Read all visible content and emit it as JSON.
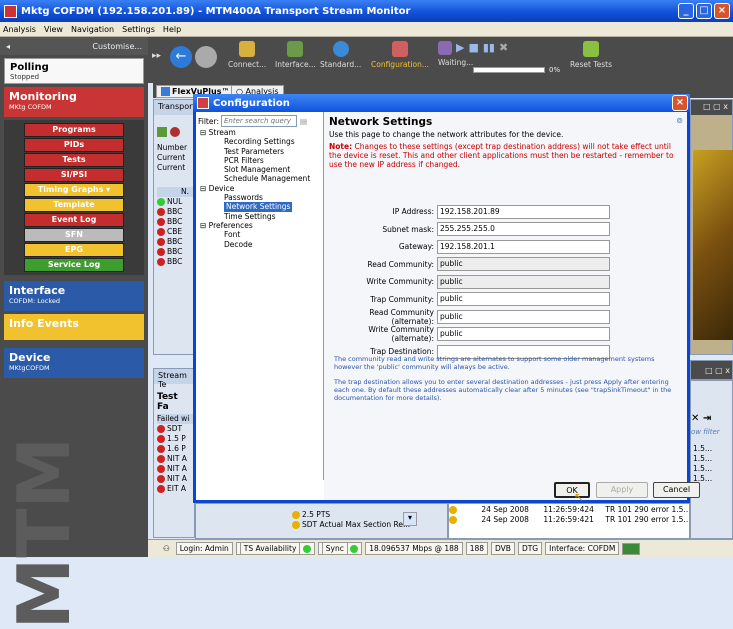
{
  "window": {
    "title": "Mktg COFDM (192.158.201.89) - MTM400A Transport Stream Monitor"
  },
  "menu": [
    "Analysis",
    "View",
    "Navigation",
    "Settings",
    "Help"
  ],
  "left": {
    "customise": "Customise...",
    "polling_title": "Polling",
    "polling_status": "Stopped",
    "monitoring_title": "Monitoring",
    "monitoring_sub": "MKtg COFDM",
    "buttons": [
      {
        "label": "Programs",
        "color": "red"
      },
      {
        "label": "PIDs",
        "color": "red"
      },
      {
        "label": "Tests",
        "color": "red"
      },
      {
        "label": "SI/PSI",
        "color": "red"
      },
      {
        "label": "Timing Graphs",
        "color": "yellow"
      },
      {
        "label": "Template",
        "color": "yellow"
      },
      {
        "label": "Event Log",
        "color": "red"
      },
      {
        "label": "SFN",
        "color": "gray"
      },
      {
        "label": "EPG",
        "color": "yellow"
      },
      {
        "label": "Service Log",
        "color": "green"
      }
    ],
    "interface_title": "Interface",
    "interface_sub": "COFDM: Locked",
    "info_title": "Info Events",
    "device_title": "Device",
    "device_sub": "MKtgCOFDM",
    "watermark": "MTM"
  },
  "toolbar": {
    "connect": "Connect...",
    "interface": "Interface...",
    "standard": "Standard...",
    "configuration": "Configuration...",
    "waiting": "Waiting...",
    "percent": "0%",
    "reset": "Reset Tests"
  },
  "tabs": {
    "flexvu": "FlexVuPlus™",
    "analysis": "Analysis"
  },
  "bg": {
    "transport_hdr": "Transport",
    "number": "Number",
    "current1": "Current",
    "current2": "Current",
    "col_n": "N.",
    "rows": [
      "NUL",
      "BBC",
      "BBC",
      "CBE",
      "BBC",
      "BBC",
      "BBC"
    ],
    "streamte": "Stream Te",
    "testfa": "Test Fa",
    "failed": "Failed wi",
    "test_rows": [
      "SDT",
      "1.5 P",
      "1.6 P",
      "NIT A",
      "NIT A",
      "NIT A",
      "EIT A"
    ],
    "pts": "2.5 PTS",
    "sdt_actual": "SDT Actual Max Section Re...",
    "row_filter": "ow filter",
    "right_vals": [
      "1.5...",
      "1.5...",
      "1.5...",
      "1.5..."
    ],
    "log": [
      {
        "date": "24 Sep 2008",
        "time": "11:26:59:424",
        "msg": "TR 101 290 error 1.5...."
      },
      {
        "date": "24 Sep 2008",
        "time": "11:26:59:421",
        "msg": "TR 101 290 error 1.5...."
      }
    ]
  },
  "status": {
    "login": "Login: Admin",
    "ts": "TS Availability",
    "sync": "Sync",
    "rate": "18.096537 Mbps @ 188",
    "size": "188",
    "dvb": "DVB",
    "dtg": "DTG",
    "iface": "Interface: COFDM"
  },
  "dialog": {
    "title": "Configuration",
    "filter_label": "Filter:",
    "filter_placeholder": "Enter search query",
    "tree": [
      {
        "label": "Stream",
        "level": 1,
        "prefix": "⊟"
      },
      {
        "label": "Recording Settings",
        "level": 2
      },
      {
        "label": "Test Parameters",
        "level": 2
      },
      {
        "label": "PCR Filters",
        "level": 2
      },
      {
        "label": "Slot Management",
        "level": 2
      },
      {
        "label": "Schedule Management",
        "level": 2
      },
      {
        "label": "Device",
        "level": 1,
        "prefix": "⊟"
      },
      {
        "label": "Passwords",
        "level": 2
      },
      {
        "label": "Network Settings",
        "level": 2,
        "selected": true
      },
      {
        "label": "Time Settings",
        "level": 2
      },
      {
        "label": "Preferences",
        "level": 1,
        "prefix": "⊟"
      },
      {
        "label": "Font",
        "level": 2
      },
      {
        "label": "Decode",
        "level": 2
      }
    ],
    "heading": "Network Settings",
    "subheading": "Use this page to change the network attributes for the device.",
    "note_label": "Note:",
    "note": " Changes to these settings (except trap destination address) will not take effect until the device is reset. This and other client applications must then be restarted - remember to use the new IP address if changed.",
    "fields": [
      {
        "label": "IP Address:",
        "value": "192.158.201.89"
      },
      {
        "label": "Subnet mask:",
        "value": "255.255.255.0"
      },
      {
        "label": "Gateway:",
        "value": "192.158.201.1"
      },
      {
        "label": "Read Community:",
        "value": "public"
      },
      {
        "label": "Write Community:",
        "value": "public"
      },
      {
        "label": "Trap Community:",
        "value": "public"
      },
      {
        "label": "Read Community (alternate):",
        "value": "public"
      },
      {
        "label": "Write Community (alternate):",
        "value": "public"
      },
      {
        "label": "Trap Destination:",
        "value": ""
      }
    ],
    "help1": "The community read and write strings are alternates to support some older management systems however the 'public' community will always be active.",
    "help2": "The trap destination allows you to enter several destination addresses - just press Apply after entering each one. By default these addresses automatically clear after 5 minutes (see \"trapSinkTimeout\" in the documentation for more details).",
    "ok": "OK",
    "apply": "Apply",
    "cancel": "Cancel"
  }
}
